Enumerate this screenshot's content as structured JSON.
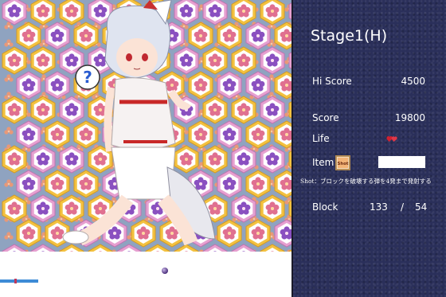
{
  "panel": {
    "stage_title": "Stage1(H)",
    "hiscore_label": "Hi Score",
    "hiscore_value": "4500",
    "score_label": "Score",
    "score_value": "19800",
    "life_label": "Life",
    "life_icon": "heart-pair-icon",
    "item_label": "Item",
    "item_icon": "shot-card-icon",
    "item_icon_text": "Shot",
    "shot_description": "Shot：ブロックを破壊する弾を4発まで発射する",
    "block_label": "Block",
    "block_count": "133",
    "block_separator": "/",
    "block_total": "54"
  },
  "playfield": {
    "bubble_icon": "question-icon",
    "bubble_text": "?",
    "ball_icon": "ball-icon",
    "paddle_icon": "paddle-icon"
  },
  "colors": {
    "panel_bg": "#2a2f5a",
    "playfield_bg": "#8fa3c0",
    "paddle": "#3d8bd6",
    "ball": "#4a2f7a",
    "heart": "#d02030",
    "hex_border_gold": "#e8b830",
    "flower_pink": "#e07090",
    "flower_purple": "#8a50c0"
  }
}
